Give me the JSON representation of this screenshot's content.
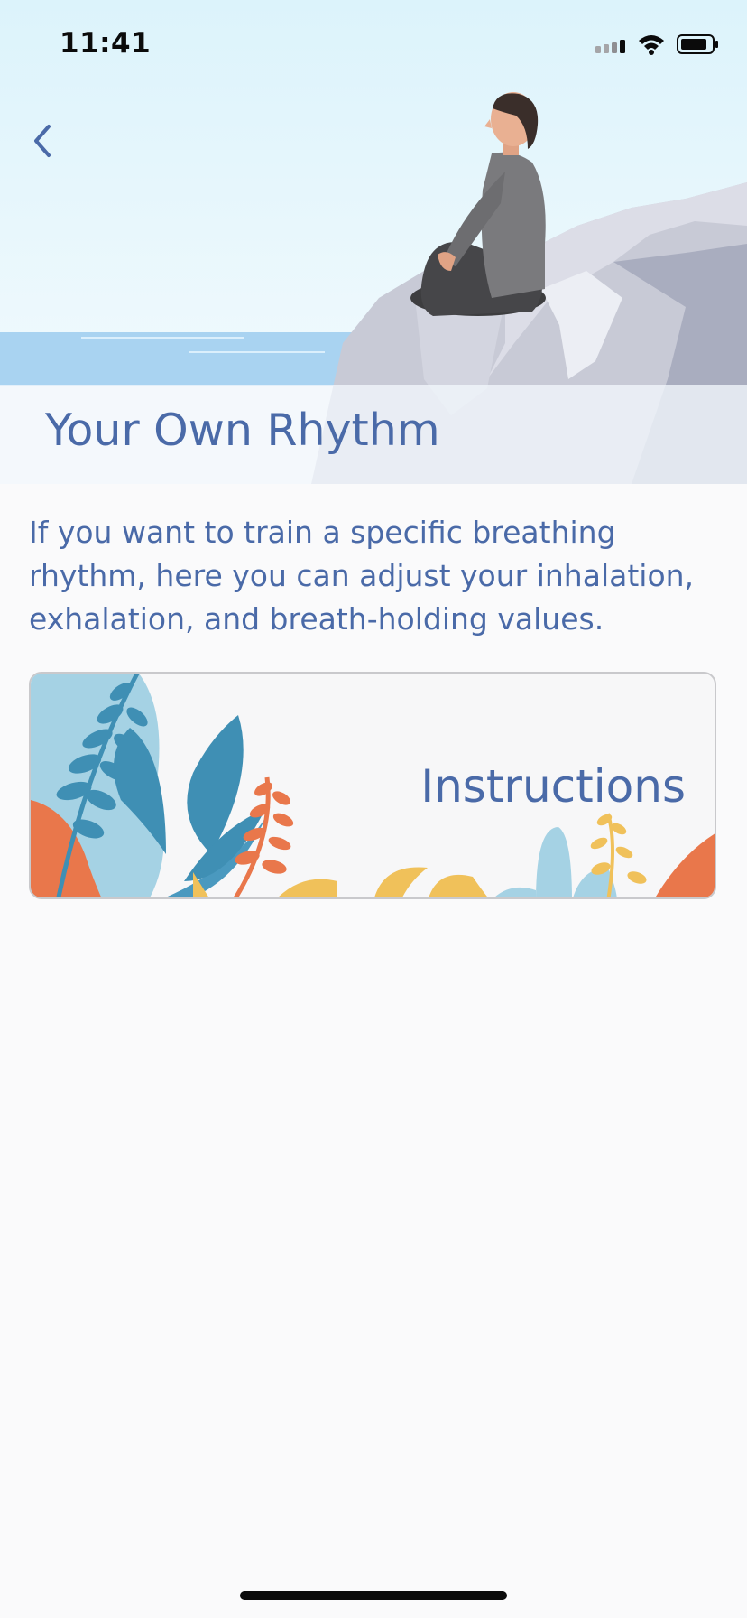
{
  "status_bar": {
    "time": "11:41"
  },
  "header": {
    "title": "Your Own Rhythm"
  },
  "main": {
    "description": "If you want to train a specific breathing rhythm, here you can adjust your inhalation, exhalation, and breath-holding values.",
    "instructions_card": {
      "label": "Instructions"
    }
  },
  "colors": {
    "accent_text": "#4a6aa8",
    "sky": "#ddf3fb",
    "sea": "#a8d2f0",
    "rock": "#c9cbd8"
  },
  "icons": [
    "back-chevron-icon",
    "signal-icon",
    "wifi-icon",
    "battery-icon"
  ]
}
